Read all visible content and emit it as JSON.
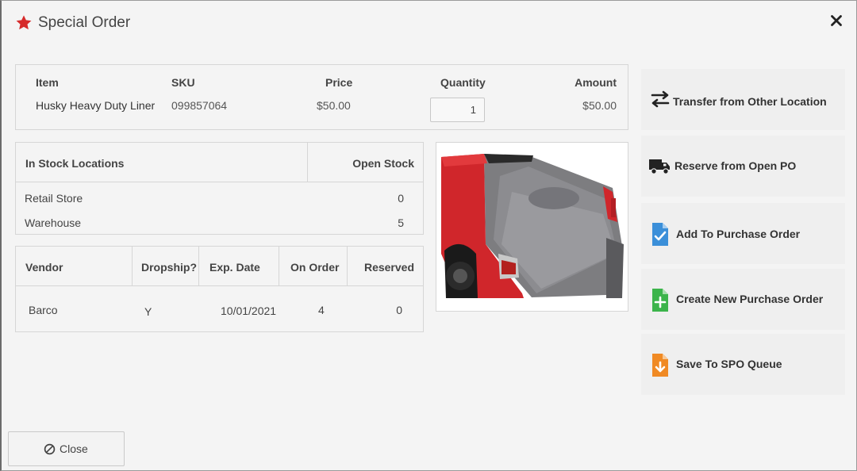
{
  "window": {
    "title": "Special Order"
  },
  "item_table": {
    "headers": {
      "item": "Item",
      "sku": "SKU",
      "price": "Price",
      "quantity": "Quantity",
      "amount": "Amount"
    },
    "row": {
      "item": "Husky Heavy Duty Liner",
      "sku": "099857064",
      "price": "$50.00",
      "quantity": "1",
      "amount": "$50.00"
    }
  },
  "stock_table": {
    "headers": {
      "location": "In Stock Locations",
      "open_stock": "Open Stock"
    },
    "rows": [
      {
        "location": "Retail Store",
        "open_stock": "0"
      },
      {
        "location": "Warehouse",
        "open_stock": "5"
      }
    ]
  },
  "vendor_table": {
    "headers": {
      "vendor": "Vendor",
      "dropship": "Dropship?",
      "exp_date": "Exp. Date",
      "on_order": "On Order",
      "reserved": "Reserved"
    },
    "rows": [
      {
        "vendor": "Barco",
        "dropship": "Y",
        "exp_date": "10/01/2021",
        "on_order": "4",
        "reserved": "0"
      }
    ]
  },
  "actions": [
    {
      "label": "Transfer from Other Location",
      "icon": "transfer-arrows-icon"
    },
    {
      "label": "Reserve from Open PO",
      "icon": "truck-icon"
    },
    {
      "label": "Add To Purchase Order",
      "icon": "document-check-icon",
      "color": "#3b8fd9"
    },
    {
      "label": "Create New Purchase Order",
      "icon": "document-plus-icon",
      "color": "#3cb44b"
    },
    {
      "label": "Save To SPO Queue",
      "icon": "document-download-icon",
      "color": "#f08a24"
    }
  ],
  "footer": {
    "close_label": "Close"
  },
  "colors": {
    "accent_star": "#d62b2b"
  }
}
